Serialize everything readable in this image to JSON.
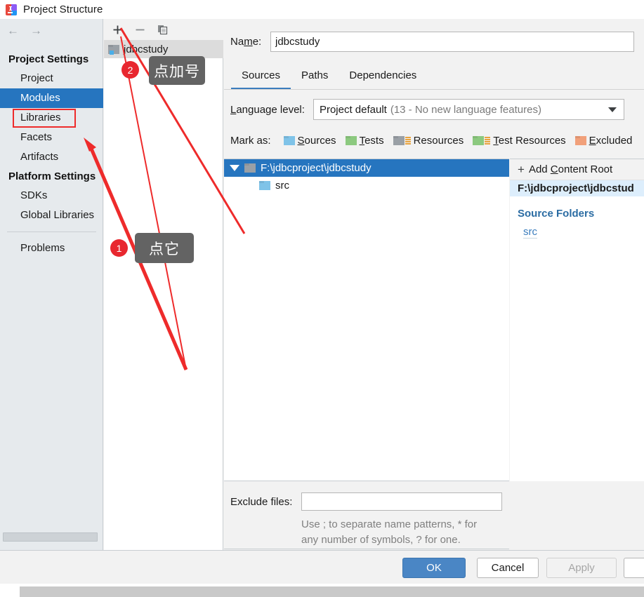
{
  "window": {
    "title": "Project Structure",
    "app_icon": "intellij-idea-icon"
  },
  "nav": {
    "back_icon": "arrow-left-icon",
    "forward_icon": "arrow-right-icon"
  },
  "sidebar": {
    "groups": [
      {
        "label": "Project Settings",
        "items": [
          {
            "label": "Project",
            "selected": false,
            "highlighted": false
          },
          {
            "label": "Modules",
            "selected": true,
            "highlighted": false
          },
          {
            "label": "Libraries",
            "selected": false,
            "highlighted": true
          },
          {
            "label": "Facets",
            "selected": false,
            "highlighted": false
          },
          {
            "label": "Artifacts",
            "selected": false,
            "highlighted": false
          }
        ]
      },
      {
        "label": "Platform Settings",
        "items": [
          {
            "label": "SDKs",
            "selected": false,
            "highlighted": false
          },
          {
            "label": "Global Libraries",
            "selected": false,
            "highlighted": false
          }
        ]
      }
    ],
    "footer_items": [
      {
        "label": "Problems"
      }
    ]
  },
  "modules_panel": {
    "toolbar": [
      {
        "name": "add-module-button",
        "glyph": "+"
      },
      {
        "name": "remove-module-button",
        "glyph": "−"
      },
      {
        "name": "copy-module-button",
        "glyph": "copy-icon"
      }
    ],
    "module_name": "jdbcstudy",
    "module_icon": "module-folder-icon"
  },
  "main": {
    "name_label": "Name:",
    "name_value": "jdbcstudy",
    "name_placeholder": "",
    "tabs": [
      {
        "label": "Sources",
        "active": true
      },
      {
        "label": "Paths",
        "active": false
      },
      {
        "label": "Dependencies",
        "active": false
      }
    ],
    "language_level": {
      "label": "Language level:",
      "value": "Project default",
      "hint": "(13 - No new language features)",
      "caret_icon": "chevron-down-icon"
    },
    "mark_as": {
      "label": "Mark as:",
      "options": [
        {
          "label": "Sources",
          "mnemonic": "S",
          "color": "#7fc3e8",
          "icon": "folder-icon"
        },
        {
          "label": "Tests",
          "mnemonic": "T",
          "color": "#8cc97f",
          "icon": "folder-icon"
        },
        {
          "label": "Resources",
          "mnemonic": "R",
          "color": "#9aa0a6",
          "icon": "folder-lines-icon"
        },
        {
          "label": "Test Resources",
          "mnemonic": "T",
          "color": "#8cc97f",
          "icon": "folder-lines-icon"
        },
        {
          "label": "Excluded",
          "mnemonic": "E",
          "color": "#f1a07a",
          "icon": "folder-icon"
        }
      ]
    },
    "content_tree": {
      "rows": [
        {
          "label": "F:\\jdbcproject\\jdbcstudy",
          "depth": 0,
          "selected": true,
          "expander_icon": "triangle-down-icon",
          "icon": "folder-icon",
          "color": "#9aa0a6"
        },
        {
          "label": "src",
          "depth": 1,
          "selected": false,
          "expander_icon": "",
          "icon": "folder-icon",
          "color": "#7fc3e8"
        }
      ]
    },
    "right_pane": {
      "add_content_root": "Add Content Root",
      "add_icon": "plus-icon",
      "root_path": "F:\\jdbcproject\\jdbcstud",
      "source_folders_header": "Source Folders",
      "source_folders": [
        "src"
      ]
    },
    "exclude": {
      "label": "Exclude files:",
      "value": "",
      "placeholder": "",
      "hint_line_1": "Use ; to separate name patterns, * for",
      "hint_line_2": "any number of symbols, ? for one."
    }
  },
  "footer": {
    "ok": "OK",
    "cancel": "Cancel",
    "apply": "Apply",
    "extra": ""
  },
  "annotations": [
    {
      "number": "1",
      "text": "点它"
    },
    {
      "number": "2",
      "text": "点加号"
    }
  ],
  "colors": {
    "accent_blue": "#2675bf",
    "annotation_red": "#ee2b2b",
    "bubble_gray": "#636363",
    "badge_red": "#e8272f",
    "ok_button": "#4a86c5"
  }
}
